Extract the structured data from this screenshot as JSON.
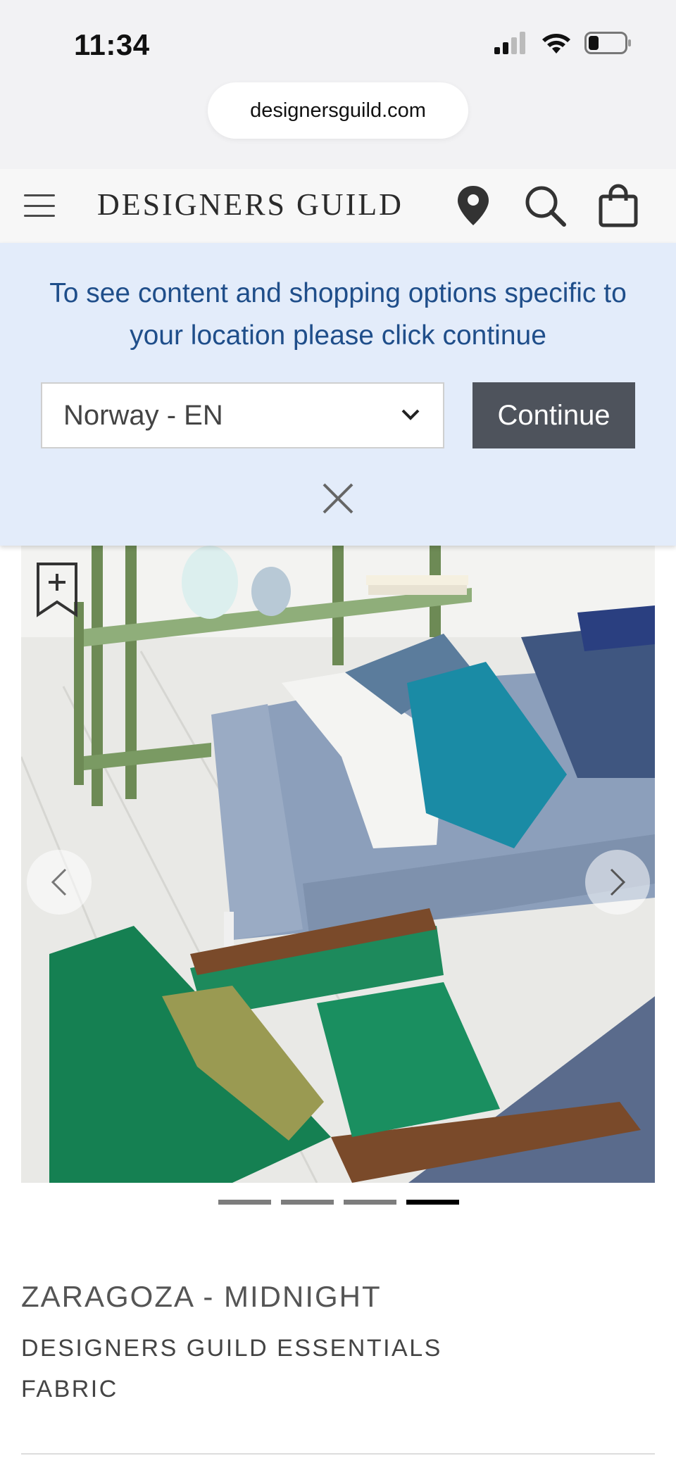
{
  "status_bar": {
    "time": "11:34"
  },
  "browser": {
    "url": "designersguild.com"
  },
  "header": {
    "logo": "DESIGNERS GUILD",
    "icons": [
      "menu-icon",
      "location-pin-icon",
      "search-icon",
      "shopping-bag-icon"
    ]
  },
  "location_banner": {
    "message": "To see content and shopping options specific to your location please click continue",
    "selected_region": "Norway - EN",
    "continue_label": "Continue"
  },
  "carousel": {
    "total_slides": 4,
    "active_slide": 4
  },
  "product": {
    "title": "ZARAGOZA - MIDNIGHT",
    "subtitle_line1": "DESIGNERS GUILD ESSENTIALS",
    "subtitle_line2": "FABRIC"
  },
  "colors": {
    "banner_bg": "#e3ecfa",
    "banner_text": "#1f4e8a",
    "continue_btn": "#4e535c",
    "active_dot": "#000000",
    "inactive_dot": "#7d7d7d"
  }
}
